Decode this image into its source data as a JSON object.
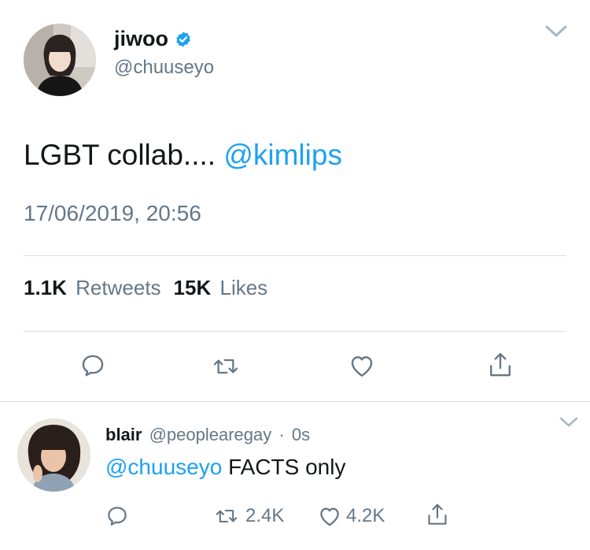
{
  "tweet": {
    "author": {
      "display_name": "jiwoo",
      "handle": "@chuuseyo",
      "verified": true
    },
    "text_prefix": "LGBT collab.... ",
    "mention": "@kimlips",
    "timestamp": "17/06/2019, 20:56",
    "stats": {
      "retweets_count": "1.1K",
      "retweets_label": "Retweets",
      "likes_count": "15K",
      "likes_label": "Likes"
    },
    "actions": [
      "reply-icon",
      "retweet-icon",
      "like-icon",
      "share-icon"
    ]
  },
  "reply": {
    "author": {
      "display_name": "blair",
      "handle": "@peoplearegay",
      "separator": "·",
      "time": "0s"
    },
    "mention": "@chuuseyo",
    "text": " FACTS only",
    "retweet_count": "2.4K",
    "like_count": "4.2K"
  },
  "colors": {
    "link": "#1da1f2",
    "verified": "#1da1f2",
    "muted": "#657786",
    "divider": "#d7dde2"
  }
}
